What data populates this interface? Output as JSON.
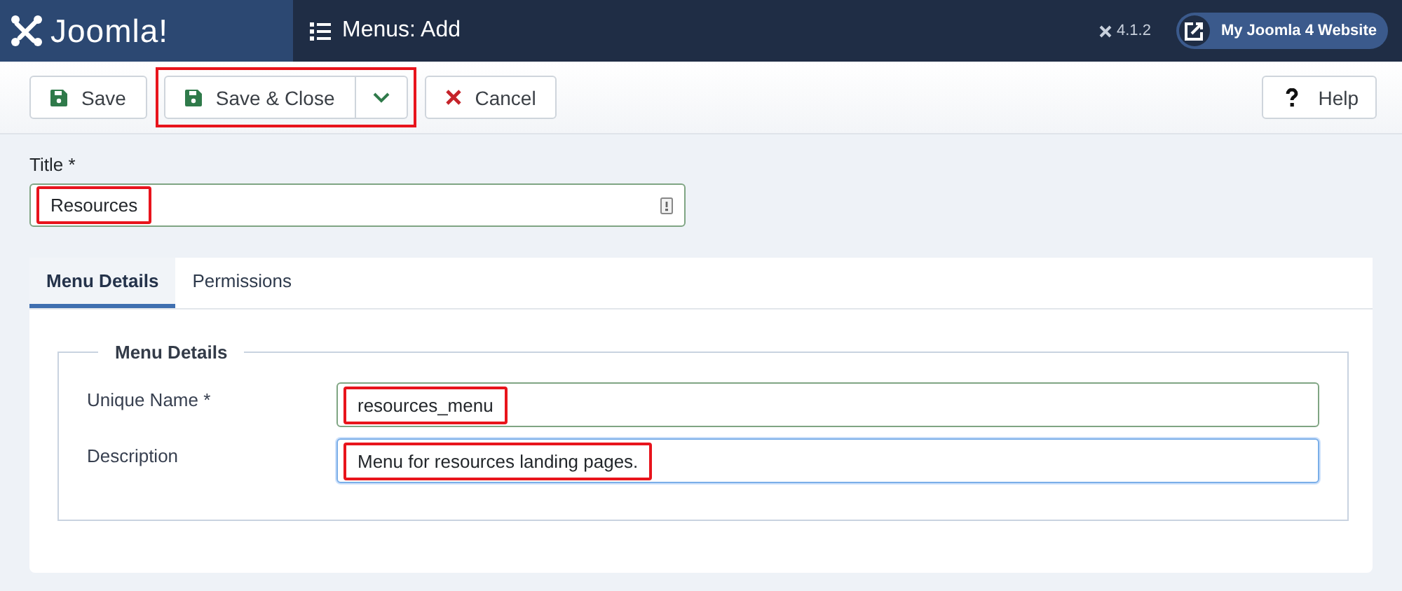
{
  "header": {
    "logo": "Joomla!",
    "title": "Menus: Add",
    "version": "4.1.2",
    "site_button": "My Joomla 4 Website"
  },
  "toolbar": {
    "buttons": [
      {
        "label": "Save",
        "kind": "save"
      },
      {
        "label": "Save & Close",
        "kind": "save-split",
        "highlighted": true
      },
      {
        "label": "Cancel",
        "kind": "cancel"
      }
    ],
    "help": "Help"
  },
  "title_field": {
    "label": "Title *",
    "value": "Resources",
    "highlighted": true
  },
  "tabs": [
    {
      "label": "Menu Details",
      "selected": true
    },
    {
      "label": "Permissions",
      "selected": false
    }
  ],
  "fieldset": {
    "legend": "Menu Details",
    "fields": [
      {
        "label": "Unique Name *",
        "value": "resources_menu",
        "highlighted": true,
        "focused": false
      },
      {
        "label": "Description",
        "value": "Menu for resources landing pages.",
        "highlighted": true,
        "focused": true
      }
    ]
  }
}
